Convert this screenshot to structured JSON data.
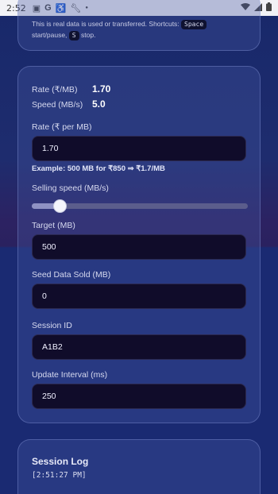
{
  "status_bar": {
    "time": "2:52",
    "icons": [
      "image-icon",
      "google-icon",
      "accessibility-icon",
      "wrench-icon",
      "dot-icon",
      "wifi-icon",
      "signal-icon",
      "battery-icon"
    ]
  },
  "info_card": {
    "hint_prefix": "This is real data is used or transferred. Shortcuts:",
    "key_space": "Space",
    "hint_mid": "start/pause,",
    "key_s": "S",
    "hint_suffix": "stop."
  },
  "stats": {
    "rate_label": "Rate (₹/MB)",
    "rate_value": "1.70",
    "speed_label": "Speed (MB/s)",
    "speed_value": "5.0"
  },
  "form": {
    "rate_label": "Rate (₹ per MB)",
    "rate_value": "1.70",
    "example": "Example: 500 MB for ₹850 ⇒ ₹1.7/MB",
    "speed_label": "Selling speed (MB/s)",
    "speed_level": 0.13,
    "target_label": "Target (MB)",
    "target_value": "500",
    "seed_label": "Seed Data Sold (MB)",
    "seed_value": "0",
    "session_label": "Session ID",
    "session_value": "A1B2",
    "interval_label": "Update Interval (ms)",
    "interval_value": "250"
  },
  "session_log": {
    "title": "Session Log",
    "lines": [
      "[2:51:27 PM]"
    ]
  },
  "colors": {
    "background": "#1a2a72",
    "field_bg": "#100c2a",
    "card_border": "#96a5e6"
  }
}
